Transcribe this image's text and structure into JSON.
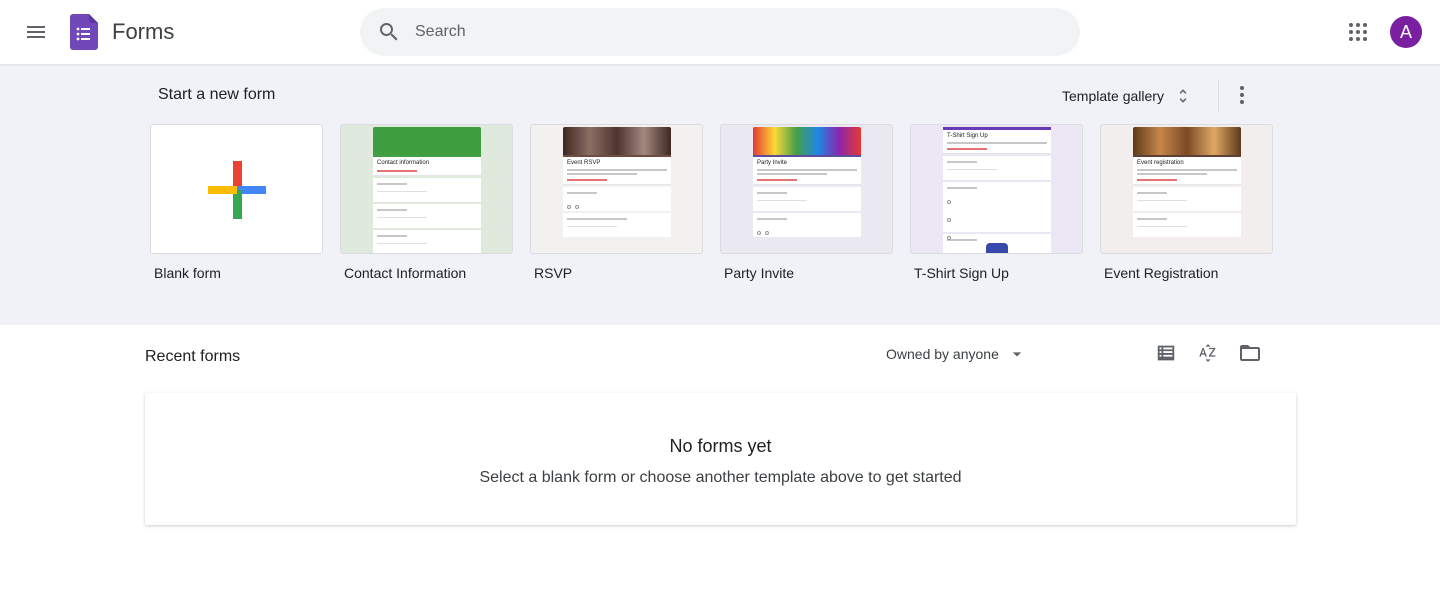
{
  "header": {
    "app_title": "Forms",
    "search": {
      "placeholder": "Search",
      "value": ""
    },
    "avatar_initial": "A"
  },
  "templates": {
    "section_title": "Start a new form",
    "gallery_label": "Template gallery",
    "items": [
      {
        "label": "Blank form"
      },
      {
        "label": "Contact Information",
        "preview_title": "Contact information",
        "banner_color": "#3f9e3f",
        "accent": "#43a047",
        "bg": "#dfe9dc"
      },
      {
        "label": "RSVP",
        "preview_title": "Event RSVP",
        "banner_color": "#5d3a32",
        "accent": "#6d4c41",
        "bg": "#f2f1f0"
      },
      {
        "label": "Party Invite",
        "preview_title": "Party Invite",
        "banner_color": "#8e8ac8",
        "accent": "#5c4d9e",
        "bg": "#eae9f2"
      },
      {
        "label": "T-Shirt Sign Up",
        "preview_title": "T-Shirt Sign Up",
        "banner_color": "#673ab7",
        "accent": "#673ab7",
        "bg": "#ece7f5"
      },
      {
        "label": "Event Registration",
        "preview_title": "Event registration",
        "banner_color": "#8d5a2b",
        "accent": "#5d4037",
        "bg": "#f3eeee"
      }
    ]
  },
  "recent": {
    "title": "Recent forms",
    "owner_filter": "Owned by anyone",
    "empty_title": "No forms yet",
    "empty_subtitle": "Select a blank form or choose another template above to get started"
  },
  "colors": {
    "brand_purple": "#7248b9",
    "avatar": "#7b1fa2",
    "google_red": "#ea4335",
    "google_blue": "#4285f4",
    "google_yellow": "#fbbc04",
    "google_green": "#34a853"
  }
}
